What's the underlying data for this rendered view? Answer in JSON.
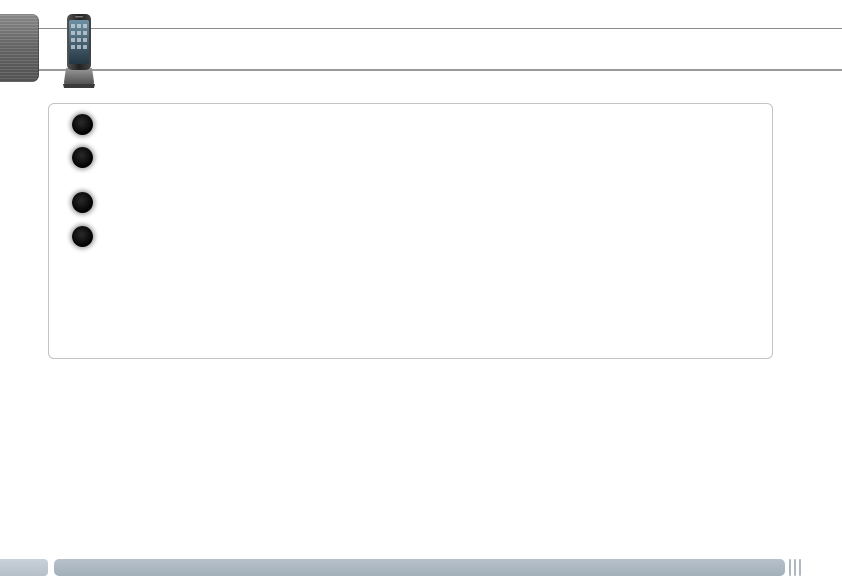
{
  "header": {
    "title": ""
  },
  "notes": {
    "items": [
      {
        "number": "",
        "text": ""
      },
      {
        "number": "",
        "text": ""
      },
      {
        "number": "",
        "text": ""
      },
      {
        "number": "",
        "text": ""
      }
    ]
  },
  "footer": {
    "page_number": ""
  },
  "colors": {
    "tab_gray": "#6a6a6a",
    "footer_blue_gray": "#a3afba",
    "rule_gray": "#8a8a8a"
  },
  "icons": {
    "header_icon": "smartphone-in-dock-icon",
    "bullet_icon": "black-circle-icon"
  }
}
